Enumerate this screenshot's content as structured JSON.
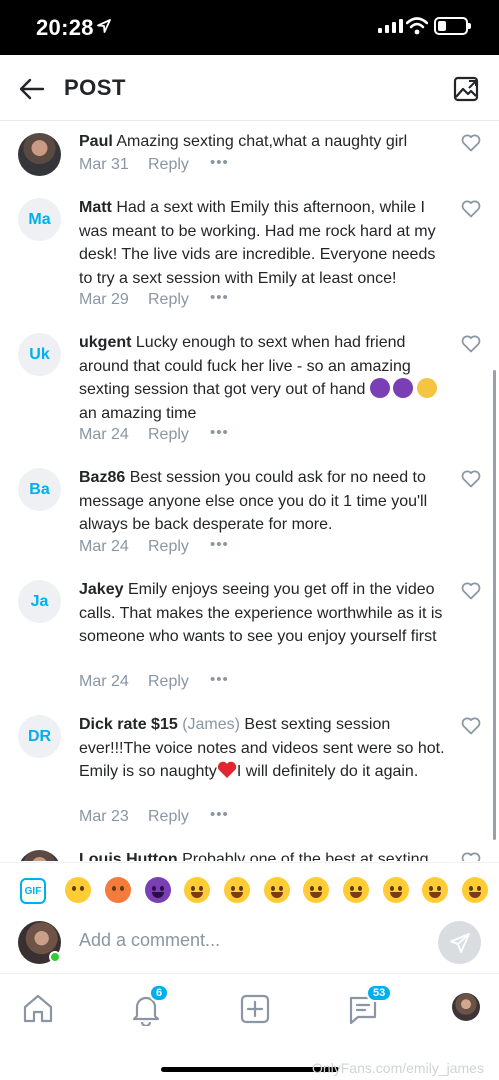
{
  "status_bar": {
    "time": "20:28"
  },
  "header": {
    "title": "POST"
  },
  "comments": [
    {
      "avatar": "",
      "name": "Paul",
      "user": "",
      "text": "Amazing sexting chat,what a naughty girl",
      "date": "Mar 31",
      "reply": "Reply",
      "more": "•••"
    },
    {
      "avatar": "Ma",
      "name": "Matt",
      "user": "",
      "text": "Had a sext with Emily this afternoon, while I was meant to be working. Had me rock hard at my desk! The live vids are incredible. Everyone needs to try a sext session with Emily at least once!",
      "date": "Mar 29",
      "reply": "Reply",
      "more": "•••"
    },
    {
      "avatar": "Uk",
      "name": "ukgent",
      "user": "",
      "text": "Lucky enough to sext when had friend around that could fuck her live - so an amazing sexting session that got very out of hand",
      "text_after": "an amazing time",
      "date": "Mar 24",
      "reply": "Reply",
      "more": "•••"
    },
    {
      "avatar": "Ba",
      "name": "Baz86",
      "user": "",
      "text": "Best session you could ask for no need to message anyone else once you do it 1 time you'll always be back desperate for more.",
      "date": "Mar 24",
      "reply": "Reply",
      "more": "•••"
    },
    {
      "avatar": "Ja",
      "name": "Jakey",
      "user": "",
      "text": "Emily enjoys seeing you get off in the video calls. That makes the experience worthwhile as it is someone who wants to see you enjoy yourself first",
      "date": "Mar 24",
      "reply": "Reply",
      "more": "•••"
    },
    {
      "avatar": "DR",
      "name": "Dick rate $15",
      "user": "(James)",
      "text": "Best sexting session ever!!!The voice notes and videos sent were so hot. Emily is so naughty",
      "text_after": "I will definitely do it again.",
      "date": "Mar 23",
      "reply": "Reply",
      "more": "•••"
    },
    {
      "avatar": "",
      "name": "Louis Hutton",
      "user": "",
      "text": "Probably one of the best at sexting",
      "date": "",
      "reply": "",
      "more": ""
    }
  ],
  "emoji_bar": {
    "gif_label": "GIF"
  },
  "comment_input": {
    "placeholder": "Add a comment..."
  },
  "nav": {
    "notifications_badge": "6",
    "messages_badge": "53"
  },
  "watermark": "OnlyFans.com/emily_james",
  "colors": {
    "accent": "#00aff0",
    "muted": "#8a96a3",
    "text": "#242529"
  }
}
